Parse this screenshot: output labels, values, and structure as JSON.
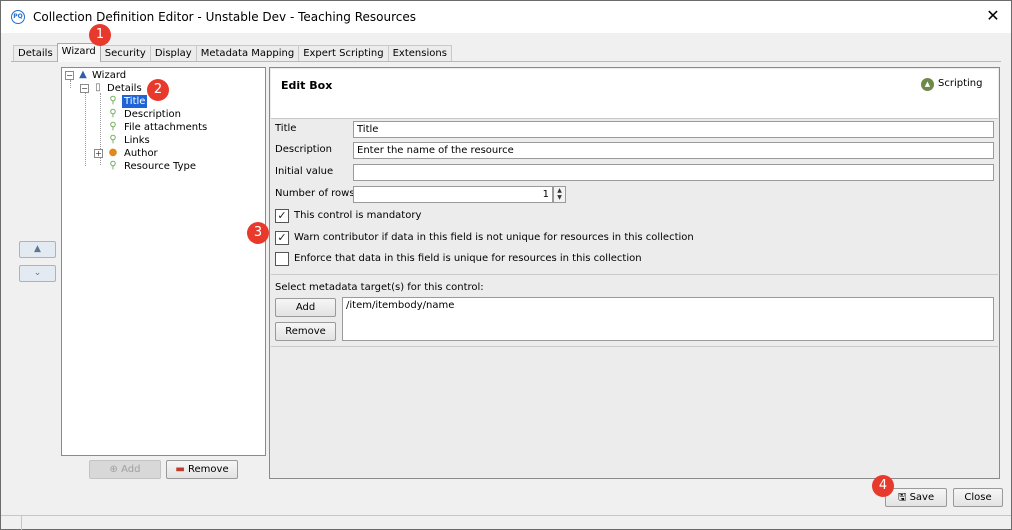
{
  "window": {
    "title": "Collection Definition Editor - Unstable Dev - Teaching Resources",
    "app_icon_text": "PQ"
  },
  "tabs": [
    {
      "label": "Details",
      "active": false
    },
    {
      "label": "Wizard",
      "active": true
    },
    {
      "label": "Security",
      "active": false
    },
    {
      "label": "Display",
      "active": false
    },
    {
      "label": "Metadata Mapping",
      "active": false
    },
    {
      "label": "Expert Scripting",
      "active": false
    },
    {
      "label": "Extensions",
      "active": false
    }
  ],
  "tree": {
    "root": "Wizard",
    "page": "Details",
    "items": [
      {
        "label": "Title",
        "selected": true,
        "icon": "key-icon"
      },
      {
        "label": "Description",
        "selected": false,
        "icon": "key-icon"
      },
      {
        "label": "File attachments",
        "selected": false,
        "icon": "key-icon"
      },
      {
        "label": "Links",
        "selected": false,
        "icon": "key-icon"
      },
      {
        "label": "Author",
        "selected": false,
        "icon": "group-icon",
        "expandable": true
      },
      {
        "label": "Resource Type",
        "selected": false,
        "icon": "key-icon"
      }
    ],
    "add_label": "Add",
    "remove_label": "Remove"
  },
  "editor": {
    "title": "Edit Box",
    "scripting_label": "Scripting",
    "fields": {
      "title_label": "Title",
      "title_value": "Title",
      "description_label": "Description",
      "description_value": "Enter the name of the resource",
      "initial_label": "Initial value",
      "initial_value": "",
      "rows_label": "Number of rows",
      "rows_value": "1"
    },
    "checkboxes": [
      {
        "label": "This control is mandatory",
        "checked": true
      },
      {
        "label": "Warn contributor if data in this field is not unique for resources in this collection",
        "checked": true
      },
      {
        "label": "Enforce that data in this field is unique for resources in this collection",
        "checked": false
      }
    ],
    "metadata": {
      "label": "Select metadata target(s) for this control:",
      "add_label": "Add",
      "remove_label": "Remove",
      "targets": [
        "/item/itembody/name"
      ]
    }
  },
  "footer": {
    "save_label": "Save",
    "close_label": "Close"
  },
  "badges": [
    "1",
    "2",
    "3",
    "4"
  ],
  "colors": {
    "badge": "#e8392d",
    "selection": "#1f64d6"
  }
}
